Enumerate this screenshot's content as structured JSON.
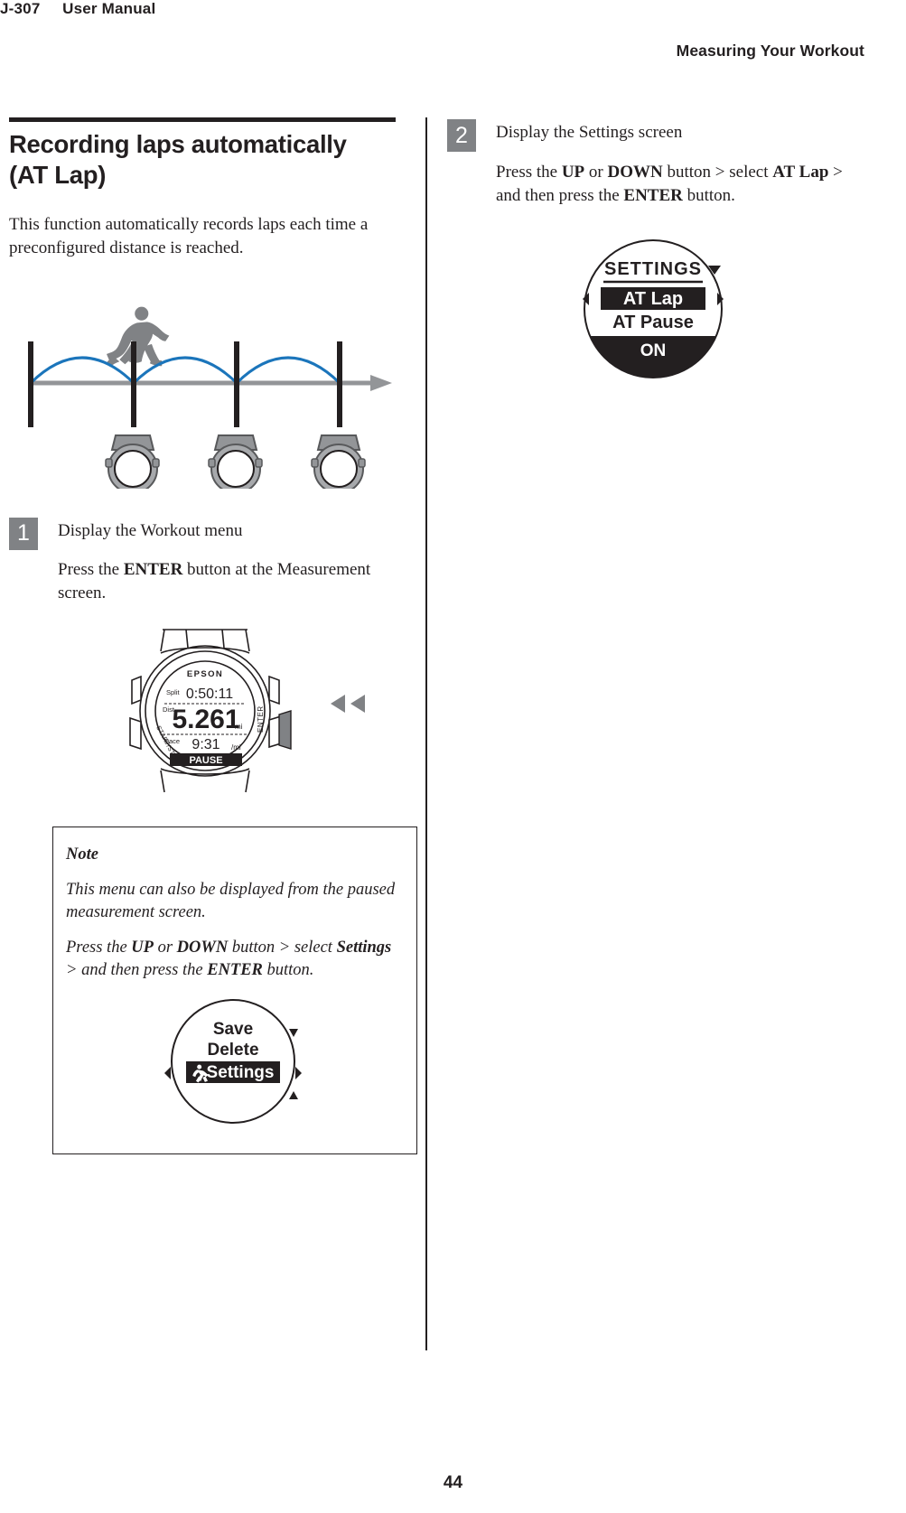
{
  "header": {
    "left": "J-307     User Manual",
    "right": "Measuring Your Workout"
  },
  "section": {
    "title_line1": "Recording laps automatically",
    "title_line2": "(AT Lap)",
    "intro": "This function automatically records laps each time a preconfigured distance is reached."
  },
  "figure_laps": {
    "name": "auto-lap-timeline-diagram",
    "runner_icon": "runner-icon",
    "arrow_icon": "right-arrow-icon",
    "watch_icon": "watch-icon",
    "tick_count": 4,
    "arc_count": 3,
    "watch_count": 3,
    "arc_color": "#1b75bb",
    "line_color": "#939598",
    "tick_color": "#231f20"
  },
  "steps": [
    {
      "number": "1",
      "title": "Display the Workout menu",
      "text_parts": [
        {
          "t": "Press the ",
          "b": false
        },
        {
          "t": "ENTER",
          "b": true
        },
        {
          "t": " button at the Measurement screen.",
          "b": false
        }
      ]
    },
    {
      "number": "2",
      "title": "Display the Settings screen",
      "text_parts": [
        {
          "t": "Press the ",
          "b": false
        },
        {
          "t": "UP",
          "b": true
        },
        {
          "t": " or ",
          "b": false
        },
        {
          "t": "DOWN",
          "b": true
        },
        {
          "t": " button > select ",
          "b": false
        },
        {
          "t": "AT Lap",
          "b": true
        },
        {
          "t": " > and then press the ",
          "b": false
        },
        {
          "t": "ENTER",
          "b": true
        },
        {
          "t": " button.",
          "b": false
        }
      ]
    }
  ],
  "watch_figure": {
    "name": "measurement-screen-watch-illustration",
    "brand": "EPSON",
    "label_split": "Split",
    "value_split": "0:50:11",
    "label_dist": "Dist.",
    "value_dist": "5.261",
    "unit_dist": "mi",
    "label_pace": "Pace",
    "value_pace": "9:31",
    "unit_pace": "/mi",
    "status": "PAUSE",
    "button_enter": "ENTER",
    "button_startstop": "START/STOP",
    "press_arrows": "left-arrow-icon"
  },
  "note": {
    "title": "Note",
    "paragraph1": "This menu can also be displayed from the paused measurement screen.",
    "paragraph2_parts": [
      {
        "t": "Press the ",
        "b": false
      },
      {
        "t": "UP",
        "b": true
      },
      {
        "t": " or ",
        "b": false
      },
      {
        "t": "DOWN",
        "b": true
      },
      {
        "t": " button > select ",
        "b": false
      },
      {
        "t": "Settings",
        "b": true
      },
      {
        "t": " > and then press the ",
        "b": false
      },
      {
        "t": "ENTER",
        "b": true
      },
      {
        "t": " button.",
        "b": false
      }
    ],
    "screen": {
      "name": "workout-menu-screen",
      "items": [
        "Save",
        "Delete",
        "Settings"
      ],
      "selected": "Settings",
      "selected_icon": "runner-icon",
      "nav_icons": [
        "caret-up-icon",
        "caret-left-icon",
        "caret-right-icon",
        "caret-down-icon"
      ]
    }
  },
  "settings_screen": {
    "name": "settings-screen",
    "title": "SETTINGS",
    "items": [
      "AT Lap",
      "AT Pause"
    ],
    "selected": "AT Lap",
    "value": "ON",
    "nav_icons": [
      "caret-down-title-icon",
      "caret-left-icon",
      "caret-right-icon"
    ]
  },
  "page_number": "44",
  "colors": {
    "ink": "#231f20",
    "badge_gray": "#808285",
    "accent_blue": "#1b75bb",
    "rule_gray": "#939598"
  }
}
